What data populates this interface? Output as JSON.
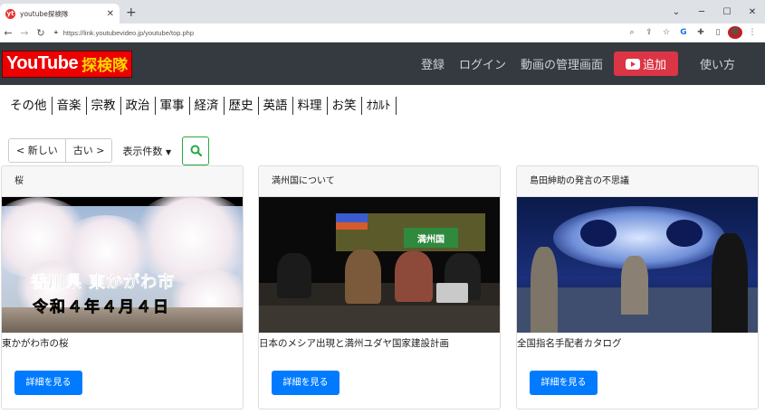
{
  "browser": {
    "tab_title": "youtube探検隊",
    "url": "https://link.youtubevideo.jp/youtube/top.php"
  },
  "header": {
    "logo_en": "YouTube",
    "logo_jp": "探検隊",
    "nav": [
      "登録",
      "ログイン",
      "動画の管理画面"
    ],
    "add_label": "追加",
    "help_label": "使い方",
    "bg_color": "#343a40",
    "accent_color": "#dc3545"
  },
  "categories": [
    "その他",
    "音楽",
    "宗教",
    "政治",
    "軍事",
    "経済",
    "歴史",
    "英語",
    "料理",
    "お笑",
    "ｵｶﾙﾄ"
  ],
  "toolbar": {
    "newer": "< 新しい",
    "older": "古い >",
    "count_label": "表示件数"
  },
  "cards": [
    {
      "header": "桜",
      "title": "東かがわ市の桜",
      "caption_line1": "香川県 東かがわ市",
      "caption_line2": "令和４年４月４日",
      "button": "詳細を見る"
    },
    {
      "header": "満州国について",
      "title": "日本のメシア出現と満州ユダヤ国家建設計画",
      "screen_text": "満州国",
      "button": "詳細を見る"
    },
    {
      "header": "島田紳助の発言の不思議",
      "title": "全国指名手配者カタログ",
      "button": "詳細を見る"
    }
  ]
}
